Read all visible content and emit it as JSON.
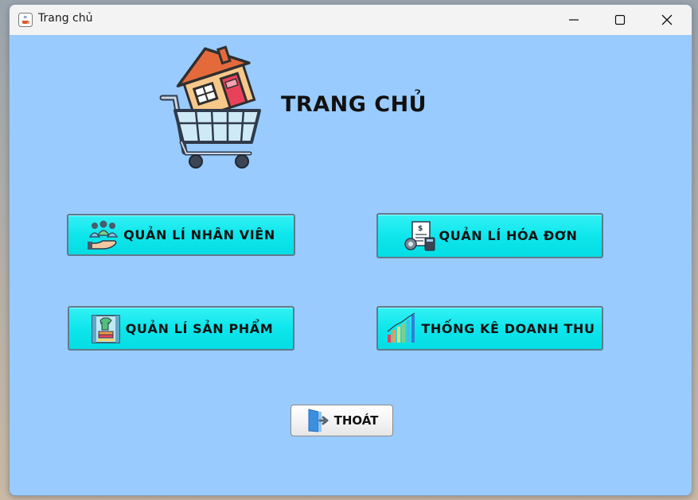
{
  "window": {
    "title": "Trang chủ",
    "controls": {
      "minimize": "minimize-icon",
      "maximize": "maximize-icon",
      "close": "close-icon"
    }
  },
  "main": {
    "heading": "TRANG CHỦ",
    "logo_icon": "shopping-cart-house-icon",
    "buttons": {
      "staff": {
        "label": "QUẢN LÍ NHÂN VIÊN",
        "icon": "staff-management-icon"
      },
      "invoice": {
        "label": "QUẢN LÍ HÓA ĐƠN",
        "icon": "invoice-icon"
      },
      "product": {
        "label": "QUẢN LÍ SẢN PHẨM",
        "icon": "product-shelf-icon"
      },
      "revenue": {
        "label": "THỐNG KÊ DOANH THU",
        "icon": "bar-chart-icon"
      },
      "exit": {
        "label": "THOÁT",
        "icon": "exit-door-icon"
      }
    }
  },
  "colors": {
    "window_background": "#99cbfe",
    "button_cyan": "#0ee6ec",
    "titlebar": "#f3f3f3"
  }
}
